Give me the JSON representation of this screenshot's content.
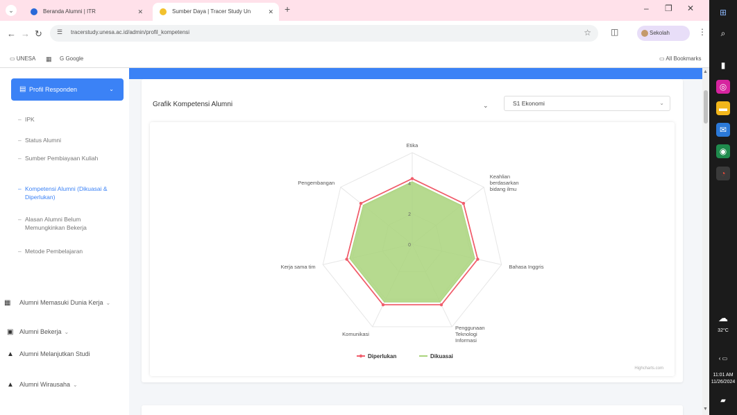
{
  "browser": {
    "tabs": [
      {
        "title": "Beranda Alumni | ITR",
        "active": false
      },
      {
        "title": "Sumber Daya | Tracer Study Un",
        "active": true
      }
    ],
    "url": "tracerstudy.unesa.ac.id/admin/profil_kompetensi",
    "profile_label": "Sekolah",
    "bookmarks": [
      "UNESA",
      "Google"
    ],
    "all_bookmarks": "All Bookmarks"
  },
  "sidebar": {
    "active_menu": "Profil Responden",
    "sub_items": [
      "IPK",
      "Status Alumni",
      "Sumber Pembiayaan Kuliah",
      "Kompetensi Alumni (Dikuasai & Diperlukan)",
      "Alasan Alumni Belum Memungkinkan Bekerja",
      "Metode Pembelajaran"
    ],
    "main_items": [
      "Alumni Memasuki Dunia Kerja",
      "Alumni Bekerja",
      "Alumni Melanjutkan Studi",
      "Alumni Wirausaha"
    ]
  },
  "card": {
    "title": "Grafik Kompetensi Alumni",
    "selected_prodi": "S1 Ekonomi"
  },
  "chart_data": {
    "type": "radar",
    "axes": [
      "Etika",
      "Keahlian berdasarkan bidang ilmu",
      "Bahasa Inggris",
      "Penggunaan Teknologi Informasi",
      "Komunikasi",
      "Kerja sama tim",
      "Pengembangan"
    ],
    "radial_ticks": [
      0,
      2,
      4
    ],
    "rmax": 6,
    "series": [
      {
        "name": "Diperlukan",
        "color": "#f05d6b",
        "values": [
          4.3,
          4.3,
          4.4,
          4.4,
          4.4,
          4.4,
          4.3
        ]
      },
      {
        "name": "Dikuasai",
        "color": "#a9d37b",
        "values": [
          4.1,
          4.1,
          4.2,
          4.2,
          4.2,
          4.2,
          4.1
        ]
      }
    ],
    "legend_position": "bottom",
    "credit": "Highcharts.com"
  },
  "taskbar": {
    "temperature": "32°C",
    "time": "11:01 AM",
    "date": "11/26/2024"
  }
}
